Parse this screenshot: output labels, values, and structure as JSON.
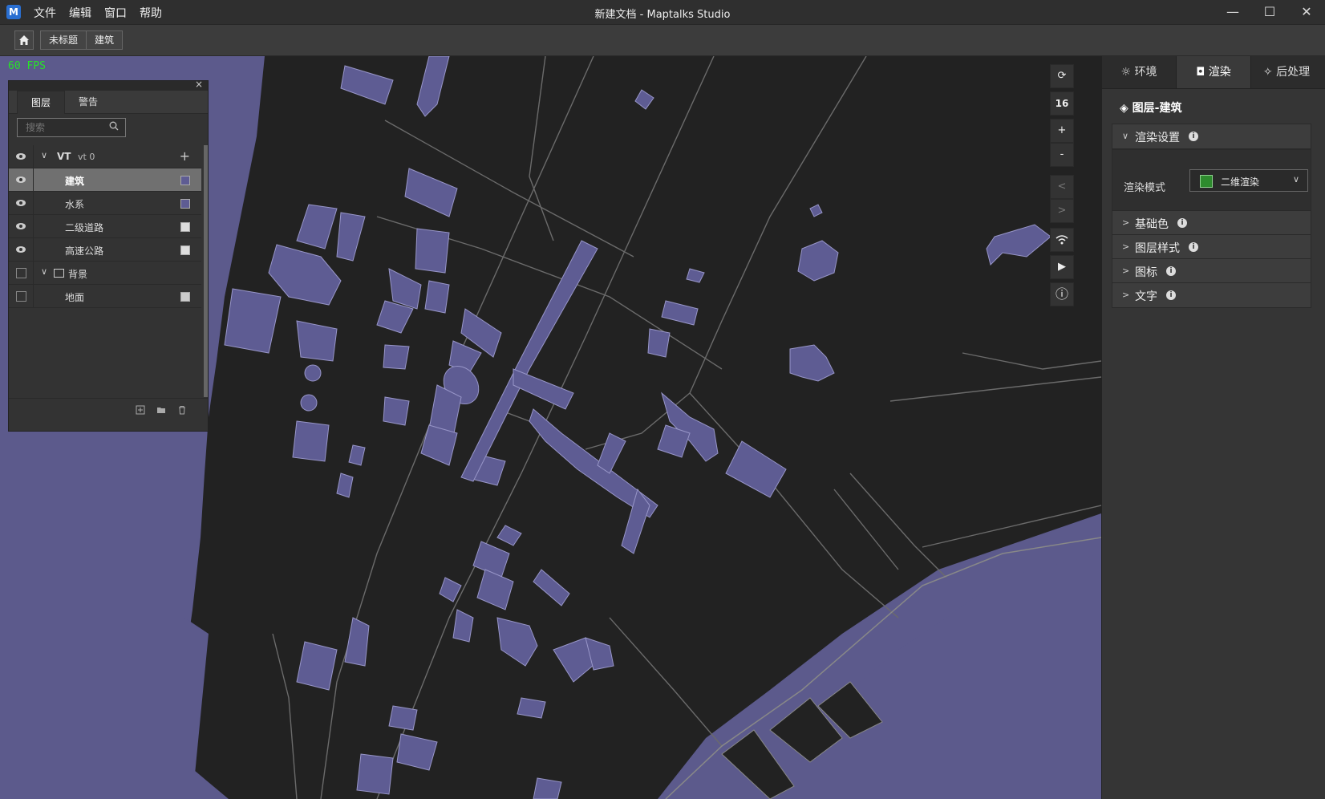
{
  "app": {
    "window_title": "新建文档 - Maptalks Studio",
    "logo": "M"
  },
  "menu": [
    "文件",
    "编辑",
    "窗口",
    "帮助"
  ],
  "window_controls": {
    "minimize": "—",
    "maximize": "☐",
    "close": "✕"
  },
  "breadcrumb": [
    "未标题",
    "建筑"
  ],
  "map": {
    "fps": "60 FPS",
    "zoom": "16",
    "colors": {
      "land": "#5c5a8c",
      "dark_area": "#222222",
      "building": "#5e5c93",
      "road": "#6b6b6b"
    },
    "tools": {
      "reset": "⟳",
      "zoom_in": "+",
      "zoom_out": "-",
      "prev": "<",
      "next": ">",
      "play": "▶",
      "info": "ⓘ"
    }
  },
  "layer_panel": {
    "close": "×",
    "tabs": [
      "图层",
      "警告"
    ],
    "search_placeholder": "搜索",
    "groups": [
      {
        "label": "VT",
        "sub": "vt 0",
        "add": "+",
        "layers": [
          {
            "name": "建筑",
            "selected": true,
            "swatch": "#5e5c93"
          },
          {
            "name": "水系",
            "selected": false,
            "swatch": "#5e5c93"
          },
          {
            "name": "二级道路",
            "selected": false,
            "swatch": "#dddddd"
          },
          {
            "name": "高速公路",
            "selected": false,
            "swatch": "#dddddd"
          }
        ]
      },
      {
        "label": "背景",
        "layers": [
          {
            "name": "地面",
            "selected": false,
            "swatch": "#cccccc"
          }
        ]
      }
    ]
  },
  "right_panel": {
    "tabs": [
      "环境",
      "渲染",
      "后处理"
    ],
    "header": "图层-建筑",
    "sections": [
      {
        "title": "渲染设置",
        "expanded": true
      },
      {
        "title": "基础色",
        "expanded": false
      },
      {
        "title": "图层样式",
        "expanded": false
      },
      {
        "title": "图标",
        "expanded": false
      },
      {
        "title": "文字",
        "expanded": false
      }
    ],
    "render_mode": {
      "label": "渲染模式",
      "value": "二维渲染"
    }
  }
}
